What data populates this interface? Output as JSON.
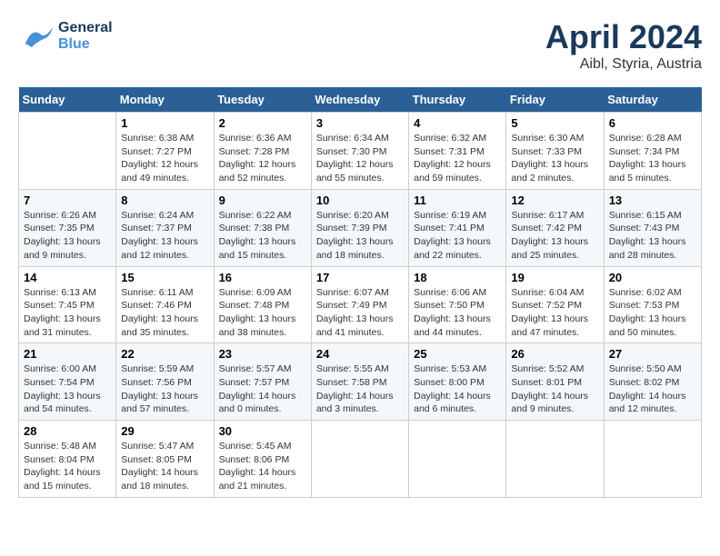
{
  "header": {
    "logo_general": "General",
    "logo_blue": "Blue",
    "month_title": "April 2024",
    "location": "Aibl, Styria, Austria"
  },
  "weekdays": [
    "Sunday",
    "Monday",
    "Tuesday",
    "Wednesday",
    "Thursday",
    "Friday",
    "Saturday"
  ],
  "weeks": [
    [
      {
        "day": "",
        "info": ""
      },
      {
        "day": "1",
        "info": "Sunrise: 6:38 AM\nSunset: 7:27 PM\nDaylight: 12 hours\nand 49 minutes."
      },
      {
        "day": "2",
        "info": "Sunrise: 6:36 AM\nSunset: 7:28 PM\nDaylight: 12 hours\nand 52 minutes."
      },
      {
        "day": "3",
        "info": "Sunrise: 6:34 AM\nSunset: 7:30 PM\nDaylight: 12 hours\nand 55 minutes."
      },
      {
        "day": "4",
        "info": "Sunrise: 6:32 AM\nSunset: 7:31 PM\nDaylight: 12 hours\nand 59 minutes."
      },
      {
        "day": "5",
        "info": "Sunrise: 6:30 AM\nSunset: 7:33 PM\nDaylight: 13 hours\nand 2 minutes."
      },
      {
        "day": "6",
        "info": "Sunrise: 6:28 AM\nSunset: 7:34 PM\nDaylight: 13 hours\nand 5 minutes."
      }
    ],
    [
      {
        "day": "7",
        "info": "Sunrise: 6:26 AM\nSunset: 7:35 PM\nDaylight: 13 hours\nand 9 minutes."
      },
      {
        "day": "8",
        "info": "Sunrise: 6:24 AM\nSunset: 7:37 PM\nDaylight: 13 hours\nand 12 minutes."
      },
      {
        "day": "9",
        "info": "Sunrise: 6:22 AM\nSunset: 7:38 PM\nDaylight: 13 hours\nand 15 minutes."
      },
      {
        "day": "10",
        "info": "Sunrise: 6:20 AM\nSunset: 7:39 PM\nDaylight: 13 hours\nand 18 minutes."
      },
      {
        "day": "11",
        "info": "Sunrise: 6:19 AM\nSunset: 7:41 PM\nDaylight: 13 hours\nand 22 minutes."
      },
      {
        "day": "12",
        "info": "Sunrise: 6:17 AM\nSunset: 7:42 PM\nDaylight: 13 hours\nand 25 minutes."
      },
      {
        "day": "13",
        "info": "Sunrise: 6:15 AM\nSunset: 7:43 PM\nDaylight: 13 hours\nand 28 minutes."
      }
    ],
    [
      {
        "day": "14",
        "info": "Sunrise: 6:13 AM\nSunset: 7:45 PM\nDaylight: 13 hours\nand 31 minutes."
      },
      {
        "day": "15",
        "info": "Sunrise: 6:11 AM\nSunset: 7:46 PM\nDaylight: 13 hours\nand 35 minutes."
      },
      {
        "day": "16",
        "info": "Sunrise: 6:09 AM\nSunset: 7:48 PM\nDaylight: 13 hours\nand 38 minutes."
      },
      {
        "day": "17",
        "info": "Sunrise: 6:07 AM\nSunset: 7:49 PM\nDaylight: 13 hours\nand 41 minutes."
      },
      {
        "day": "18",
        "info": "Sunrise: 6:06 AM\nSunset: 7:50 PM\nDaylight: 13 hours\nand 44 minutes."
      },
      {
        "day": "19",
        "info": "Sunrise: 6:04 AM\nSunset: 7:52 PM\nDaylight: 13 hours\nand 47 minutes."
      },
      {
        "day": "20",
        "info": "Sunrise: 6:02 AM\nSunset: 7:53 PM\nDaylight: 13 hours\nand 50 minutes."
      }
    ],
    [
      {
        "day": "21",
        "info": "Sunrise: 6:00 AM\nSunset: 7:54 PM\nDaylight: 13 hours\nand 54 minutes."
      },
      {
        "day": "22",
        "info": "Sunrise: 5:59 AM\nSunset: 7:56 PM\nDaylight: 13 hours\nand 57 minutes."
      },
      {
        "day": "23",
        "info": "Sunrise: 5:57 AM\nSunset: 7:57 PM\nDaylight: 14 hours\nand 0 minutes."
      },
      {
        "day": "24",
        "info": "Sunrise: 5:55 AM\nSunset: 7:58 PM\nDaylight: 14 hours\nand 3 minutes."
      },
      {
        "day": "25",
        "info": "Sunrise: 5:53 AM\nSunset: 8:00 PM\nDaylight: 14 hours\nand 6 minutes."
      },
      {
        "day": "26",
        "info": "Sunrise: 5:52 AM\nSunset: 8:01 PM\nDaylight: 14 hours\nand 9 minutes."
      },
      {
        "day": "27",
        "info": "Sunrise: 5:50 AM\nSunset: 8:02 PM\nDaylight: 14 hours\nand 12 minutes."
      }
    ],
    [
      {
        "day": "28",
        "info": "Sunrise: 5:48 AM\nSunset: 8:04 PM\nDaylight: 14 hours\nand 15 minutes."
      },
      {
        "day": "29",
        "info": "Sunrise: 5:47 AM\nSunset: 8:05 PM\nDaylight: 14 hours\nand 18 minutes."
      },
      {
        "day": "30",
        "info": "Sunrise: 5:45 AM\nSunset: 8:06 PM\nDaylight: 14 hours\nand 21 minutes."
      },
      {
        "day": "",
        "info": ""
      },
      {
        "day": "",
        "info": ""
      },
      {
        "day": "",
        "info": ""
      },
      {
        "day": "",
        "info": ""
      }
    ]
  ]
}
